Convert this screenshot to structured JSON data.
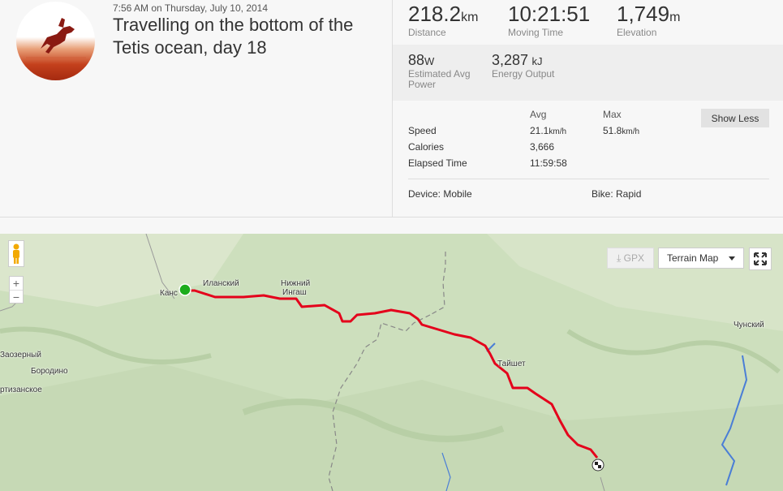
{
  "activity": {
    "datetime": "7:56 AM on Thursday, July 10, 2014",
    "title": "Travelling on the bottom of the Tetis ocean, day 18"
  },
  "primary_stats": [
    {
      "value": "218.2",
      "unit": "km",
      "label": "Distance"
    },
    {
      "value": "10:21:51",
      "unit": "",
      "label": "Moving Time"
    },
    {
      "value": "1,749",
      "unit": "m",
      "label": "Elevation"
    }
  ],
  "secondary_stats": [
    {
      "value": "88",
      "unit": "W",
      "label_line1": "Estimated Avg",
      "label_line2": "Power"
    },
    {
      "value": "3,287",
      "unit": "kJ",
      "label_line1": "Energy Output",
      "label_line2": ""
    }
  ],
  "more_stats": {
    "col_avg": "Avg",
    "col_max": "Max",
    "rows": [
      {
        "label": "Speed",
        "avg": "21.1",
        "avg_unit": "km/h",
        "max": "51.8",
        "max_unit": "km/h"
      },
      {
        "label": "Calories",
        "avg": "3,666",
        "avg_unit": "",
        "max": "",
        "max_unit": ""
      },
      {
        "label": "Elapsed Time",
        "avg": "11:59:58",
        "avg_unit": "",
        "max": "",
        "max_unit": ""
      }
    ],
    "show_less_label": "Show Less",
    "device": "Device: Mobile",
    "bike": "Bike: Rapid"
  },
  "map": {
    "gpx_label": "GPX",
    "map_type": "Terrain Map",
    "zoom_in": "+",
    "zoom_out": "−",
    "places": {
      "kansk": "Канс",
      "ilanskiy": "Иланский",
      "nizhniy_ingash_1": "Нижний",
      "nizhniy_ingash_2": "Ингаш",
      "tayshet": "Тайшет",
      "chunskiy": "Чунский",
      "zaozerny": "Заозерный",
      "borodino": "Бородино",
      "partizanskoe": "ртизанское"
    },
    "route_color": "#e4001b",
    "start_color": "#1cac1c"
  }
}
